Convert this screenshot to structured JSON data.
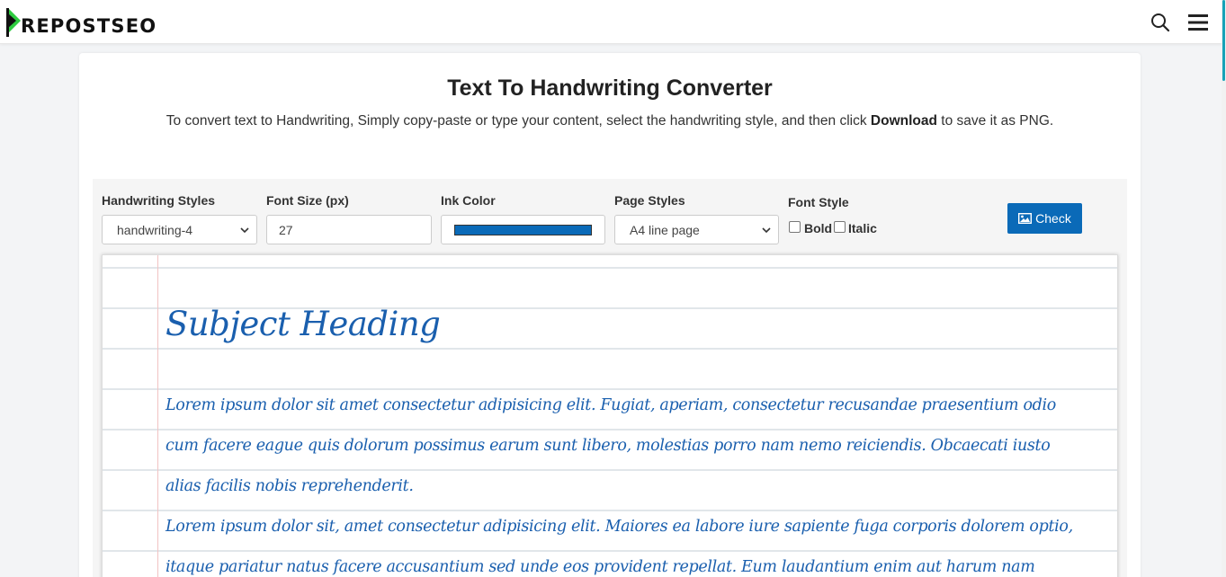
{
  "header": {
    "logo_text": "REPOSTSEO",
    "search_icon": "search-icon",
    "menu_icon": "hamburger-menu-icon"
  },
  "page": {
    "title": "Text To Handwriting Converter",
    "subtitle_before": "To convert text to Handwriting, Simply copy-paste or type your content, select the handwriting style, and then click ",
    "subtitle_bold": "Download",
    "subtitle_after": " to save it as PNG."
  },
  "controls": {
    "handwriting_styles": {
      "label": "Handwriting Styles",
      "value": "handwriting-4"
    },
    "font_size": {
      "label": "Font Size (px)",
      "value": "27"
    },
    "ink_color": {
      "label": "Ink Color",
      "value": "#0a6ab8"
    },
    "page_styles": {
      "label": "Page Styles",
      "value": "A4 line page"
    },
    "font_style": {
      "label": "Font Style",
      "bold_label": "Bold",
      "italic_label": "Italic"
    },
    "check_button": {
      "label": "Check",
      "icon": "image-icon"
    }
  },
  "paper": {
    "heading": "Subject Heading",
    "lines": [
      "Lorem ipsum dolor sit amet consectetur adipisicing elit. Fugiat, aperiam, consectetur recusandae praesentium odio",
      "cum facere eague quis dolorum possimus earum sunt libero, molestias porro nam nemo reiciendis. Obcaecati iusto",
      "alias facilis nobis reprehenderit.",
      "Lorem ipsum dolor sit, amet consectetur adipisicing elit. Maiores ea labore iure sapiente fuga corporis dolorem optio,",
      "itaque pariatur natus facere accusantium sed unde eos provident repellat. Eum laudantium enim aut harum nam"
    ]
  },
  "colors": {
    "accent": "#0a6ab8",
    "ink": "#1a5fae",
    "logo_green": "#2ecc40"
  }
}
